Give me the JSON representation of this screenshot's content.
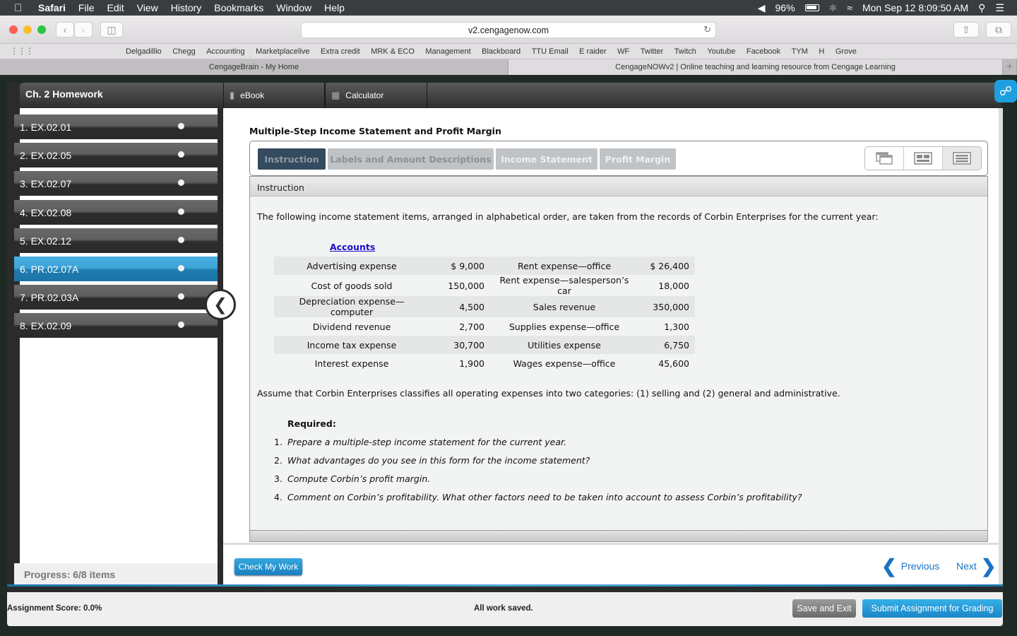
{
  "menubar": {
    "app": "Safari",
    "items": [
      "File",
      "Edit",
      "View",
      "History",
      "Bookmarks",
      "Window",
      "Help"
    ],
    "battery": "96%",
    "clock": "Mon Sep 12  8:09:50 AM"
  },
  "browser": {
    "url": "v2.cengagenow.com",
    "bookmarks": [
      "Delgadillio",
      "Chegg",
      "Accounting",
      "Marketplacelive",
      "Extra credit",
      "MRK & ECO",
      "Management",
      "Blackboard",
      "TTU Email",
      "E raider",
      "WF",
      "Twitter",
      "Twitch",
      "Youtube",
      "Facebook",
      "TYM",
      "H",
      "Grove"
    ],
    "tabs": [
      {
        "label": "CengageBrain - My Home",
        "active": false
      },
      {
        "label": "CengageNOWv2 | Online teaching and learning resource from Cengage Learning",
        "active": true
      }
    ]
  },
  "sidebar": {
    "title": "Ch. 2 Homework",
    "items": [
      {
        "label": "1. EX.02.01",
        "active": false
      },
      {
        "label": "2. EX.02.05",
        "active": false
      },
      {
        "label": "3. EX.02.07",
        "active": false
      },
      {
        "label": "4. EX.02.08",
        "active": false
      },
      {
        "label": "5. EX.02.12",
        "active": false
      },
      {
        "label": "6. PR.02.07A",
        "active": true
      },
      {
        "label": "7. PR.02.03A",
        "active": false
      },
      {
        "label": "8. EX.02.09",
        "active": false
      }
    ],
    "progress": "Progress:  6/8 items"
  },
  "topbar": {
    "ebook": "eBook",
    "calculator": "Calculator"
  },
  "problem": {
    "title": "Multiple-Step Income Statement and Profit Margin",
    "tabs": [
      {
        "label": "Instruction",
        "active": true
      },
      {
        "label": "Labels and Amount Descriptions",
        "active": false
      },
      {
        "label": "Income Statement",
        "active": false
      },
      {
        "label": "Profit Margin",
        "active": false
      }
    ],
    "section_header": "Instruction",
    "intro": "The following income statement items, arranged in alphabetical order, are taken from the records of Corbin Enterprises for the current year:",
    "accounts_heading": "Accounts",
    "accounts": [
      {
        "name1": "Advertising expense",
        "val1": "$ 9,000",
        "name2": "Rent expense—office",
        "val2": "$ 26,400"
      },
      {
        "name1": "Cost of goods sold",
        "val1": "150,000",
        "name2": "Rent expense—salesperson’s car",
        "val2": "18,000"
      },
      {
        "name1": "Depreciation expense—computer",
        "val1": "4,500",
        "name2": "Sales revenue",
        "val2": "350,000"
      },
      {
        "name1": "Dividend revenue",
        "val1": "2,700",
        "name2": "Supplies expense—office",
        "val2": "1,300"
      },
      {
        "name1": "Income tax expense",
        "val1": "30,700",
        "name2": "Utilities expense",
        "val2": "6,750"
      },
      {
        "name1": "Interest expense",
        "val1": "1,900",
        "name2": "Wages expense—office",
        "val2": "45,600"
      }
    ],
    "assumption": "Assume that Corbin Enterprises classifies all operating expenses into two categories: (1) selling and (2) general and administrative.",
    "required_heading": "Required:",
    "required": [
      {
        "n": "1.",
        "text": "Prepare a multiple-step income statement for the current year."
      },
      {
        "n": "2.",
        "text": "What advantages do you see in this form for the income statement?"
      },
      {
        "n": "3.",
        "text": "Compute Corbin’s profit margin."
      },
      {
        "n": "4.",
        "text": "Comment on Corbin’s profitability. What other factors need to be taken into account to assess Corbin’s profitability?"
      }
    ]
  },
  "actions": {
    "check": "Check My Work",
    "previous": "Previous",
    "next": "Next"
  },
  "footer": {
    "score": "Assignment Score: 0.0%",
    "status": "All work saved.",
    "save_exit": "Save and Exit",
    "submit": "Submit Assignment for Grading"
  },
  "colors": {
    "accent_blue": "#1e9fde",
    "active_tab": "#344a5e",
    "link": "#1a0dcc"
  }
}
